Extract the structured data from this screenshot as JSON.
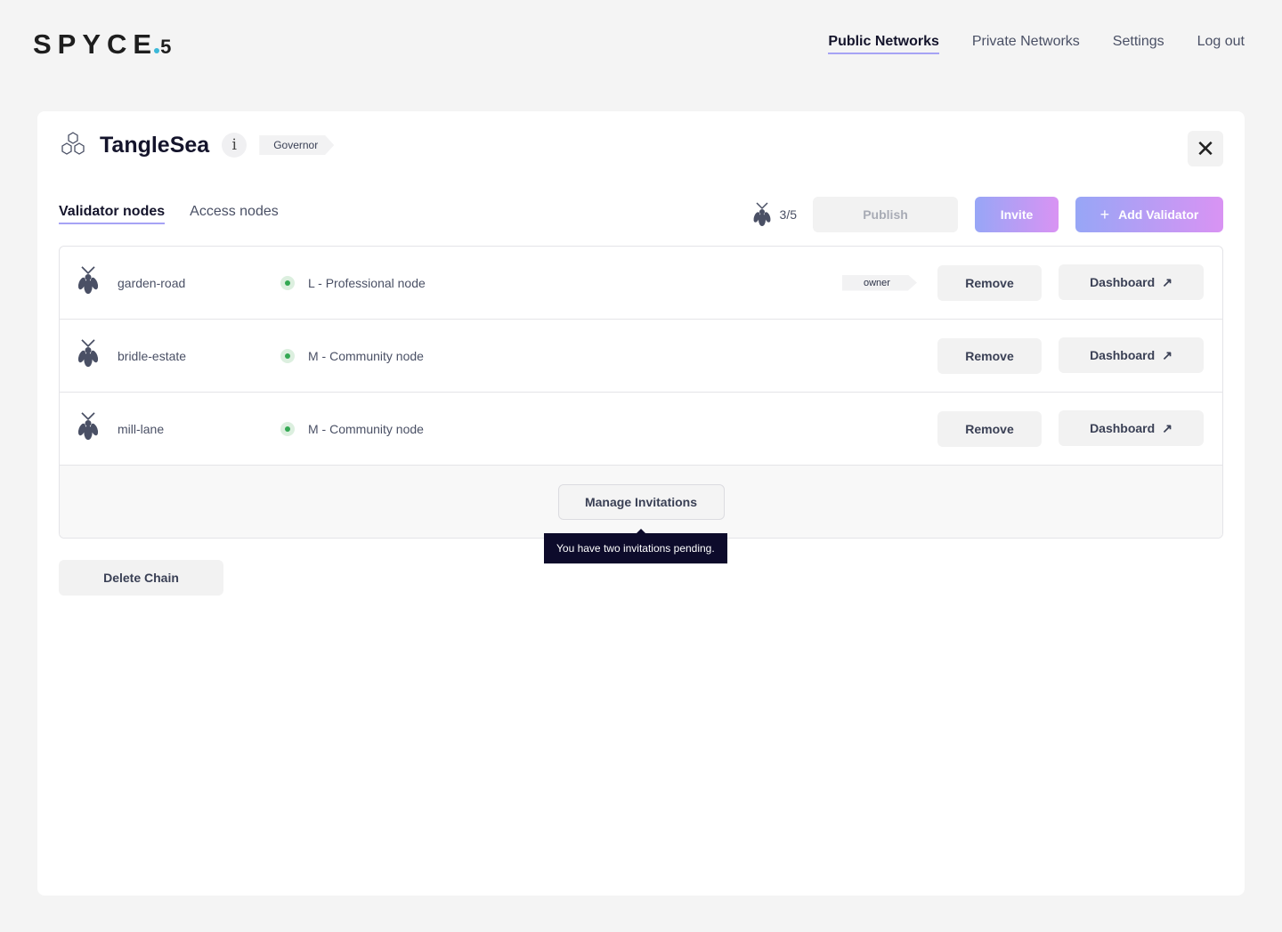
{
  "logo": {
    "text": "SPYCE",
    "suffix": "5",
    "dot_color": "#3bb8d8"
  },
  "nav": {
    "items": [
      "Public Networks",
      "Private Networks",
      "Settings",
      "Log out"
    ],
    "active": "Public Networks"
  },
  "network": {
    "title": "TangleSea",
    "info": "i",
    "role": "Governor"
  },
  "tabs": [
    "Validator nodes",
    "Access nodes"
  ],
  "actions": {
    "count": "3/5",
    "publish": "Publish",
    "invite": "Invite",
    "add_validator": "Add Validator"
  },
  "nodes": [
    {
      "name": "garden-road",
      "type": "L - Professional node",
      "badge": "owner",
      "remove": "Remove",
      "dashboard": "Dashboard"
    },
    {
      "name": "bridle-estate",
      "type": "M - Community node",
      "remove": "Remove",
      "dashboard": "Dashboard"
    },
    {
      "name": "mill-lane",
      "type": "M - Community node",
      "remove": "Remove",
      "dashboard": "Dashboard"
    }
  ],
  "manage_invitations": "Manage Invitations",
  "tooltip": "You have two invitations pending.",
  "delete_chain": "Delete Chain"
}
